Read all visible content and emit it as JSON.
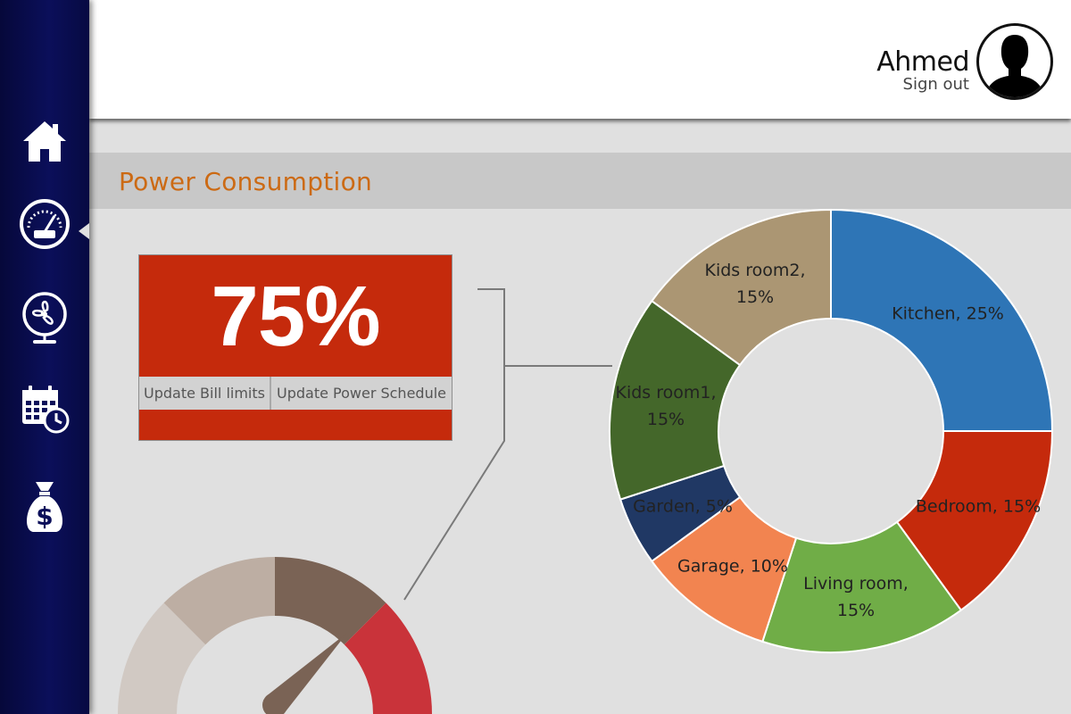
{
  "header": {
    "user_name": "Ahmed",
    "sign_out_label": "Sign out"
  },
  "sidebar": {
    "items": [
      {
        "name": "home",
        "icon": "home-icon"
      },
      {
        "name": "dashboard",
        "icon": "gauge-icon",
        "active": true
      },
      {
        "name": "devices",
        "icon": "fan-icon"
      },
      {
        "name": "schedule",
        "icon": "calendar-clock-icon"
      },
      {
        "name": "bill",
        "icon": "money-bag-icon"
      }
    ]
  },
  "section": {
    "title": "Power Consumption"
  },
  "usage_card": {
    "value": "75%",
    "update_bill_limits_label": "Update Bill limits",
    "update_power_schedule_label": "Update Power Schedule"
  },
  "gauge": {
    "level_fraction": 0.75,
    "colors": [
      "#d1c9c3",
      "#bdaea3",
      "#7a6355",
      "#c9333a"
    ]
  },
  "chart_data": {
    "type": "pie",
    "donut": true,
    "slices": [
      {
        "label": "Kitchen",
        "value": 25,
        "display": "Kitchen, 25%",
        "color": "#2e75b6"
      },
      {
        "label": "Bedroom",
        "value": 15,
        "display": "Bedroom, 15%",
        "color": "#c52a0c"
      },
      {
        "label": "Living room",
        "value": 15,
        "display": "Living room, 15%",
        "color": "#70ad47"
      },
      {
        "label": "Garage",
        "value": 10,
        "display": "Garage, 10%",
        "color": "#f28450"
      },
      {
        "label": "Garden",
        "value": 5,
        "display": "Garden, 5%",
        "color": "#203864"
      },
      {
        "label": "Kids room1",
        "value": 15,
        "display": "Kids room1, 15%",
        "color": "#44672a"
      },
      {
        "label": "Kids room2",
        "value": 15,
        "display": "Kids room2, 15%",
        "color": "#ab9673"
      }
    ]
  }
}
